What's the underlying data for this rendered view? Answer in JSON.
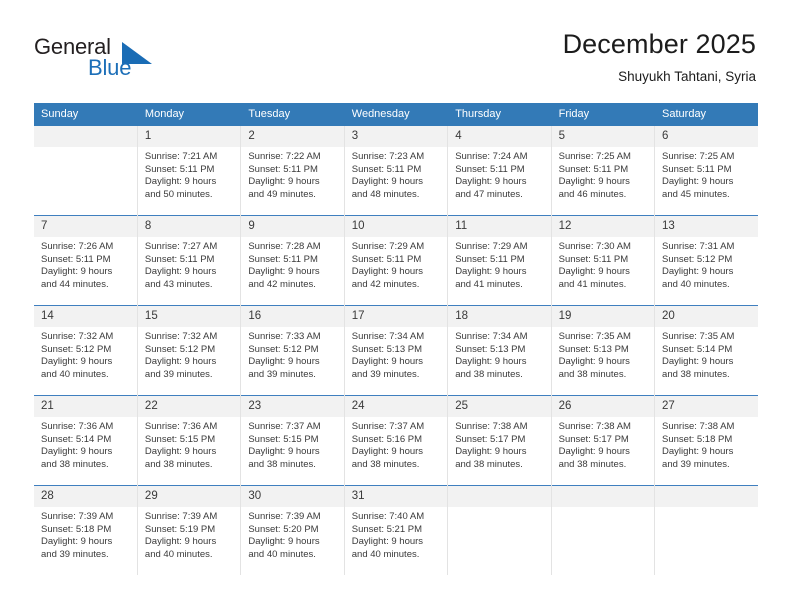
{
  "brand": {
    "name_top": "General",
    "name_bottom": "Blue",
    "triangle_icon": "triangle-icon",
    "color_primary": "#1a6cb5",
    "color_text": "#231f20"
  },
  "header": {
    "title": "December 2025",
    "subtitle": "Shuyukh Tahtani, Syria"
  },
  "calendar": {
    "header_bg": "#337ab7",
    "header_text_color": "#ffffff",
    "daynum_bg": "#f2f2f2",
    "row_divider_color": "#3f7fbf",
    "weekdays": [
      "Sunday",
      "Monday",
      "Tuesday",
      "Wednesday",
      "Thursday",
      "Friday",
      "Saturday"
    ],
    "weeks": [
      [
        {
          "day": "",
          "sunrise": "",
          "sunset": "",
          "daylight1": "",
          "daylight2": ""
        },
        {
          "day": "1",
          "sunrise": "Sunrise: 7:21 AM",
          "sunset": "Sunset: 5:11 PM",
          "daylight1": "Daylight: 9 hours",
          "daylight2": "and 50 minutes."
        },
        {
          "day": "2",
          "sunrise": "Sunrise: 7:22 AM",
          "sunset": "Sunset: 5:11 PM",
          "daylight1": "Daylight: 9 hours",
          "daylight2": "and 49 minutes."
        },
        {
          "day": "3",
          "sunrise": "Sunrise: 7:23 AM",
          "sunset": "Sunset: 5:11 PM",
          "daylight1": "Daylight: 9 hours",
          "daylight2": "and 48 minutes."
        },
        {
          "day": "4",
          "sunrise": "Sunrise: 7:24 AM",
          "sunset": "Sunset: 5:11 PM",
          "daylight1": "Daylight: 9 hours",
          "daylight2": "and 47 minutes."
        },
        {
          "day": "5",
          "sunrise": "Sunrise: 7:25 AM",
          "sunset": "Sunset: 5:11 PM",
          "daylight1": "Daylight: 9 hours",
          "daylight2": "and 46 minutes."
        },
        {
          "day": "6",
          "sunrise": "Sunrise: 7:25 AM",
          "sunset": "Sunset: 5:11 PM",
          "daylight1": "Daylight: 9 hours",
          "daylight2": "and 45 minutes."
        }
      ],
      [
        {
          "day": "7",
          "sunrise": "Sunrise: 7:26 AM",
          "sunset": "Sunset: 5:11 PM",
          "daylight1": "Daylight: 9 hours",
          "daylight2": "and 44 minutes."
        },
        {
          "day": "8",
          "sunrise": "Sunrise: 7:27 AM",
          "sunset": "Sunset: 5:11 PM",
          "daylight1": "Daylight: 9 hours",
          "daylight2": "and 43 minutes."
        },
        {
          "day": "9",
          "sunrise": "Sunrise: 7:28 AM",
          "sunset": "Sunset: 5:11 PM",
          "daylight1": "Daylight: 9 hours",
          "daylight2": "and 42 minutes."
        },
        {
          "day": "10",
          "sunrise": "Sunrise: 7:29 AM",
          "sunset": "Sunset: 5:11 PM",
          "daylight1": "Daylight: 9 hours",
          "daylight2": "and 42 minutes."
        },
        {
          "day": "11",
          "sunrise": "Sunrise: 7:29 AM",
          "sunset": "Sunset: 5:11 PM",
          "daylight1": "Daylight: 9 hours",
          "daylight2": "and 41 minutes."
        },
        {
          "day": "12",
          "sunrise": "Sunrise: 7:30 AM",
          "sunset": "Sunset: 5:11 PM",
          "daylight1": "Daylight: 9 hours",
          "daylight2": "and 41 minutes."
        },
        {
          "day": "13",
          "sunrise": "Sunrise: 7:31 AM",
          "sunset": "Sunset: 5:12 PM",
          "daylight1": "Daylight: 9 hours",
          "daylight2": "and 40 minutes."
        }
      ],
      [
        {
          "day": "14",
          "sunrise": "Sunrise: 7:32 AM",
          "sunset": "Sunset: 5:12 PM",
          "daylight1": "Daylight: 9 hours",
          "daylight2": "and 40 minutes."
        },
        {
          "day": "15",
          "sunrise": "Sunrise: 7:32 AM",
          "sunset": "Sunset: 5:12 PM",
          "daylight1": "Daylight: 9 hours",
          "daylight2": "and 39 minutes."
        },
        {
          "day": "16",
          "sunrise": "Sunrise: 7:33 AM",
          "sunset": "Sunset: 5:12 PM",
          "daylight1": "Daylight: 9 hours",
          "daylight2": "and 39 minutes."
        },
        {
          "day": "17",
          "sunrise": "Sunrise: 7:34 AM",
          "sunset": "Sunset: 5:13 PM",
          "daylight1": "Daylight: 9 hours",
          "daylight2": "and 39 minutes."
        },
        {
          "day": "18",
          "sunrise": "Sunrise: 7:34 AM",
          "sunset": "Sunset: 5:13 PM",
          "daylight1": "Daylight: 9 hours",
          "daylight2": "and 38 minutes."
        },
        {
          "day": "19",
          "sunrise": "Sunrise: 7:35 AM",
          "sunset": "Sunset: 5:13 PM",
          "daylight1": "Daylight: 9 hours",
          "daylight2": "and 38 minutes."
        },
        {
          "day": "20",
          "sunrise": "Sunrise: 7:35 AM",
          "sunset": "Sunset: 5:14 PM",
          "daylight1": "Daylight: 9 hours",
          "daylight2": "and 38 minutes."
        }
      ],
      [
        {
          "day": "21",
          "sunrise": "Sunrise: 7:36 AM",
          "sunset": "Sunset: 5:14 PM",
          "daylight1": "Daylight: 9 hours",
          "daylight2": "and 38 minutes."
        },
        {
          "day": "22",
          "sunrise": "Sunrise: 7:36 AM",
          "sunset": "Sunset: 5:15 PM",
          "daylight1": "Daylight: 9 hours",
          "daylight2": "and 38 minutes."
        },
        {
          "day": "23",
          "sunrise": "Sunrise: 7:37 AM",
          "sunset": "Sunset: 5:15 PM",
          "daylight1": "Daylight: 9 hours",
          "daylight2": "and 38 minutes."
        },
        {
          "day": "24",
          "sunrise": "Sunrise: 7:37 AM",
          "sunset": "Sunset: 5:16 PM",
          "daylight1": "Daylight: 9 hours",
          "daylight2": "and 38 minutes."
        },
        {
          "day": "25",
          "sunrise": "Sunrise: 7:38 AM",
          "sunset": "Sunset: 5:17 PM",
          "daylight1": "Daylight: 9 hours",
          "daylight2": "and 38 minutes."
        },
        {
          "day": "26",
          "sunrise": "Sunrise: 7:38 AM",
          "sunset": "Sunset: 5:17 PM",
          "daylight1": "Daylight: 9 hours",
          "daylight2": "and 38 minutes."
        },
        {
          "day": "27",
          "sunrise": "Sunrise: 7:38 AM",
          "sunset": "Sunset: 5:18 PM",
          "daylight1": "Daylight: 9 hours",
          "daylight2": "and 39 minutes."
        }
      ],
      [
        {
          "day": "28",
          "sunrise": "Sunrise: 7:39 AM",
          "sunset": "Sunset: 5:18 PM",
          "daylight1": "Daylight: 9 hours",
          "daylight2": "and 39 minutes."
        },
        {
          "day": "29",
          "sunrise": "Sunrise: 7:39 AM",
          "sunset": "Sunset: 5:19 PM",
          "daylight1": "Daylight: 9 hours",
          "daylight2": "and 40 minutes."
        },
        {
          "day": "30",
          "sunrise": "Sunrise: 7:39 AM",
          "sunset": "Sunset: 5:20 PM",
          "daylight1": "Daylight: 9 hours",
          "daylight2": "and 40 minutes."
        },
        {
          "day": "31",
          "sunrise": "Sunrise: 7:40 AM",
          "sunset": "Sunset: 5:21 PM",
          "daylight1": "Daylight: 9 hours",
          "daylight2": "and 40 minutes."
        },
        {
          "day": "",
          "sunrise": "",
          "sunset": "",
          "daylight1": "",
          "daylight2": ""
        },
        {
          "day": "",
          "sunrise": "",
          "sunset": "",
          "daylight1": "",
          "daylight2": ""
        },
        {
          "day": "",
          "sunrise": "",
          "sunset": "",
          "daylight1": "",
          "daylight2": ""
        }
      ]
    ]
  }
}
